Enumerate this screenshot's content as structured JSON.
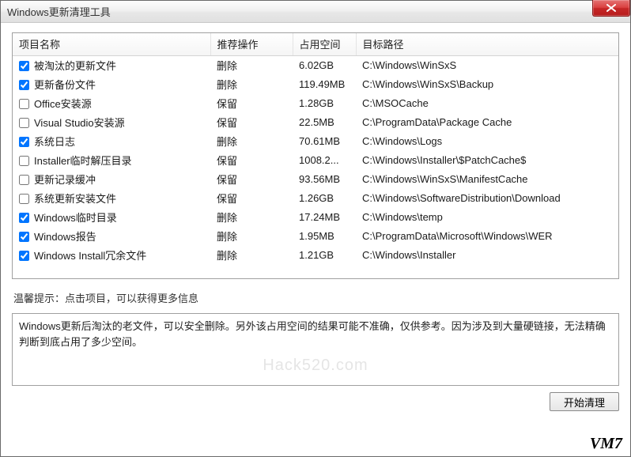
{
  "window": {
    "title": "Windows更新清理工具"
  },
  "columns": {
    "name": "项目名称",
    "action": "推荐操作",
    "size": "占用空间",
    "path": "目标路径"
  },
  "items": [
    {
      "checked": true,
      "name": "被淘汰的更新文件",
      "action": "删除",
      "size": "6.02GB",
      "path": "C:\\Windows\\WinSxS"
    },
    {
      "checked": true,
      "name": "更新备份文件",
      "action": "删除",
      "size": "119.49MB",
      "path": "C:\\Windows\\WinSxS\\Backup"
    },
    {
      "checked": false,
      "name": "Office安装源",
      "action": "保留",
      "size": "1.28GB",
      "path": "C:\\MSOCache"
    },
    {
      "checked": false,
      "name": "Visual Studio安装源",
      "action": "保留",
      "size": "22.5MB",
      "path": "C:\\ProgramData\\Package Cache"
    },
    {
      "checked": true,
      "name": "系统日志",
      "action": "删除",
      "size": "70.61MB",
      "path": "C:\\Windows\\Logs"
    },
    {
      "checked": false,
      "name": "Installer临时解压目录",
      "action": "保留",
      "size": "1008.2...",
      "path": "C:\\Windows\\Installer\\$PatchCache$"
    },
    {
      "checked": false,
      "name": "更新记录缓冲",
      "action": "保留",
      "size": "93.56MB",
      "path": "C:\\Windows\\WinSxS\\ManifestCache"
    },
    {
      "checked": false,
      "name": "系统更新安装文件",
      "action": "保留",
      "size": "1.26GB",
      "path": "C:\\Windows\\SoftwareDistribution\\Download"
    },
    {
      "checked": true,
      "name": "Windows临时目录",
      "action": "删除",
      "size": "17.24MB",
      "path": "C:\\Windows\\temp"
    },
    {
      "checked": true,
      "name": "Windows报告",
      "action": "删除",
      "size": "1.95MB",
      "path": "C:\\ProgramData\\Microsoft\\Windows\\WER"
    },
    {
      "checked": true,
      "name": "Windows Install冗余文件",
      "action": "删除",
      "size": "1.21GB",
      "path": "C:\\Windows\\Installer"
    }
  ],
  "hint": "温馨提示：点击项目，可以获得更多信息",
  "description": "Windows更新后淘汰的老文件，可以安全删除。另外该占用空间的结果可能不准确，仅供参考。因为涉及到大量硬链接，无法精确判断到底占用了多少空间。",
  "watermark": "Hack520.com",
  "buttons": {
    "start": "开始清理"
  },
  "vm_label": "VM7"
}
